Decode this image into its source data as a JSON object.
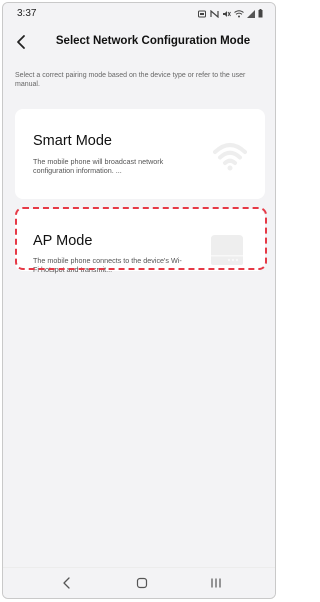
{
  "status_bar": {
    "time": "3:37",
    "icons": [
      "notification-icon",
      "nfc-icon",
      "mute-icon",
      "wifi-signal-icon",
      "cell-signal-icon",
      "battery-icon"
    ]
  },
  "header": {
    "back_icon": "chevron-left-icon",
    "title": "Select Network Configuration Mode"
  },
  "instruction": "Select a correct pairing mode based on the device type or refer to the user manual.",
  "modes": [
    {
      "title": "Smart Mode",
      "description": "The mobile phone will broadcast network configuration information. ...",
      "icon": "wifi-icon",
      "highlighted": false
    },
    {
      "title": "AP Mode",
      "description": "The mobile phone connects to the device's Wi-Fi hotspot and transmit...",
      "icon": "router-icon",
      "highlighted": true
    }
  ],
  "nav_bar": {
    "back_icon": "nav-back-icon",
    "home_icon": "nav-home-icon",
    "recent_icon": "nav-recent-apps-icon"
  },
  "colors": {
    "background": "#f3f3f5",
    "card": "#ffffff",
    "highlight": "#e63946",
    "icon_gray": "#eeeeee"
  }
}
